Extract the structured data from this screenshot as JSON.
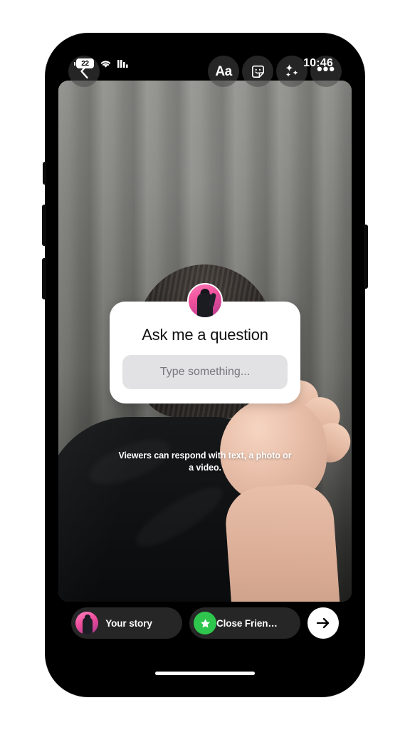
{
  "status_bar": {
    "battery_level": "22",
    "battery_icon": "battery-icon",
    "wifi_icon": "wifi-icon",
    "signal_icon": "cellular-signal-icon",
    "time": "10:46"
  },
  "toolbar": {
    "back_icon": "chevron-left-icon",
    "text_tool_label": "Aa",
    "sticker_icon": "sticker-smiley-icon",
    "effects_icon": "sparkles-icon",
    "more_icon": "more-horizontal-icon"
  },
  "question_sticker": {
    "avatar_icon": "profile-avatar",
    "title": "Ask me a question",
    "input_placeholder": "Type something...",
    "input_value": "",
    "hint": "Viewers can respond with text, a photo or a video."
  },
  "bottom_bar": {
    "your_story": {
      "label": "Your story",
      "avatar_icon": "profile-avatar"
    },
    "close_friends": {
      "label": "Close Friends",
      "badge_icon": "green-star-icon",
      "badge_color": "#2ec64d"
    },
    "send_icon": "arrow-right-icon"
  },
  "theme": {
    "screen_background": "#000000",
    "card_background": "#ffffff",
    "input_background": "#e2e2e4",
    "pill_background": "#262626",
    "accent_green": "#2ec64d",
    "accent_pink": "#ef4e9c"
  }
}
